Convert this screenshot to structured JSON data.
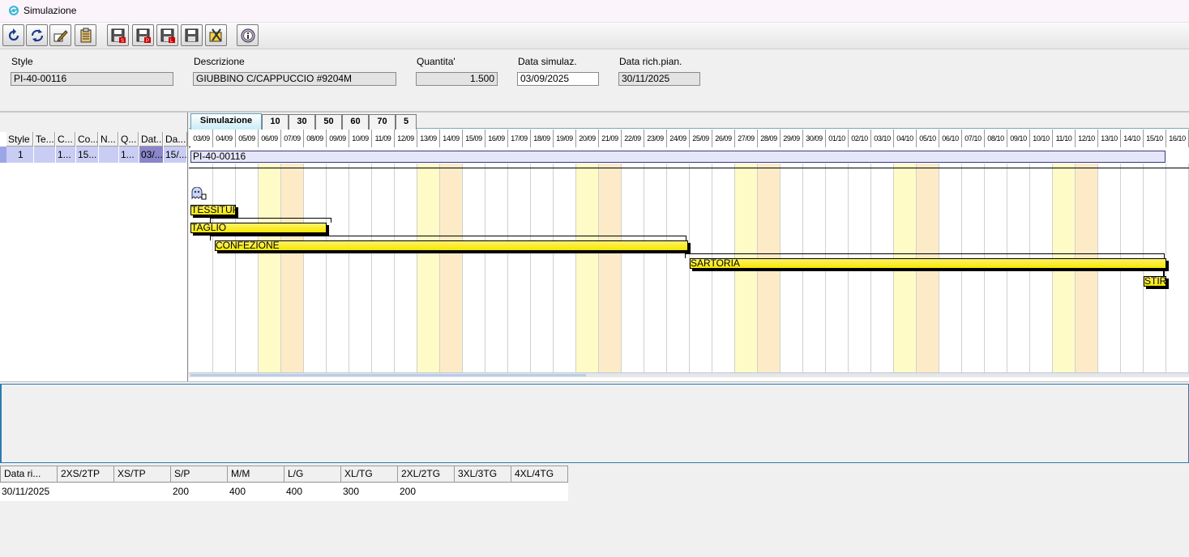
{
  "window": {
    "title": "Simulazione",
    "app_icon": "refresh-app-icon"
  },
  "toolbar": {
    "buttons": [
      {
        "name": "undo-button",
        "icon": "undo-icon"
      },
      {
        "name": "refresh-button",
        "icon": "refresh-icon"
      },
      {
        "name": "edit-button",
        "icon": "edit-icon"
      },
      {
        "name": "clipboard-button",
        "icon": "clipboard-icon"
      },
      {
        "name": "save-button",
        "icon": "floppy-icon",
        "letter": "S"
      },
      {
        "name": "save-p-button",
        "icon": "floppy-icon",
        "letter": "P"
      },
      {
        "name": "save-l-button",
        "icon": "floppy-icon",
        "letter": "L"
      },
      {
        "name": "save-plain-button",
        "icon": "floppy-icon",
        "letter": ""
      },
      {
        "name": "tools-button",
        "icon": "tools-icon"
      },
      {
        "name": "info-button",
        "icon": "info-icon"
      }
    ]
  },
  "form": {
    "style_label": "Style",
    "style_value": "PI-40-00116",
    "descrizione_label": "Descrizione",
    "descrizione_value": "GIUBBINO C/CAPPUCCIO  #9204M",
    "quantita_label": "Quantita'",
    "quantita_value": "1.500",
    "data_simulaz_label": "Data simulaz.",
    "data_simulaz_value": "03/09/2025",
    "data_rich_label": "Data rich.pian.",
    "data_rich_value": "30/11/2025"
  },
  "left_grid": {
    "headers": [
      "Style",
      "Te...",
      "C...",
      "Co...",
      "N...",
      "Q...",
      "Dat...",
      "Da..."
    ],
    "row": [
      "1",
      "",
      "1...",
      "15...",
      "",
      "1...",
      "03/...",
      "15/..."
    ]
  },
  "gantt": {
    "tabs": [
      "Simulazione",
      "10",
      "30",
      "50",
      "60",
      "70",
      "5"
    ],
    "active_tab": "Simulazione",
    "dates": [
      "03/09",
      "04/09",
      "05/09",
      "06/09",
      "07/09",
      "08/09",
      "09/09",
      "10/09",
      "11/09",
      "12/09",
      "13/09",
      "14/09",
      "15/09",
      "16/09",
      "17/09",
      "18/09",
      "19/09",
      "20/09",
      "21/09",
      "22/09",
      "23/09",
      "24/09",
      "25/09",
      "26/09",
      "27/09",
      "28/09",
      "29/09",
      "30/09",
      "01/10",
      "02/10",
      "03/10",
      "04/10",
      "05/10",
      "06/10",
      "07/10",
      "08/10",
      "09/10",
      "10/10",
      "11/10",
      "12/10",
      "13/10",
      "14/10",
      "15/10",
      "16/10"
    ],
    "weekend_colors": {
      "saturday": "#fefbc6",
      "sunday": "#fdebc8"
    },
    "summary_bar": {
      "label": "PI-40-00116",
      "start": "03/09",
      "end": "15/10"
    },
    "milestone_icon": "ghost-icon",
    "phases": [
      {
        "label": "TESSITUR",
        "start": "03/09",
        "end": "04/09"
      },
      {
        "label": "TAGLIO",
        "start": "03/09",
        "end": "08/09"
      },
      {
        "label": "CONFEZIONE",
        "start": "04/09",
        "end": "24/09"
      },
      {
        "label": "SARTORIA",
        "start": "25/09",
        "end": "15/10"
      },
      {
        "label": "STIR",
        "start": "15/10",
        "end": "15/10"
      }
    ],
    "bar_color": "#f5e800"
  },
  "size_table": {
    "headers": [
      "Data ri...",
      "2XS/2TP",
      "XS/TP",
      "S/P",
      "M/M",
      "L/G",
      "XL/TG",
      "2XL/2TG",
      "3XL/3TG",
      "4XL/4TG"
    ],
    "row": [
      "30/11/2025",
      "",
      "",
      "200",
      "400",
      "400",
      "300",
      "200",
      "",
      ""
    ]
  }
}
